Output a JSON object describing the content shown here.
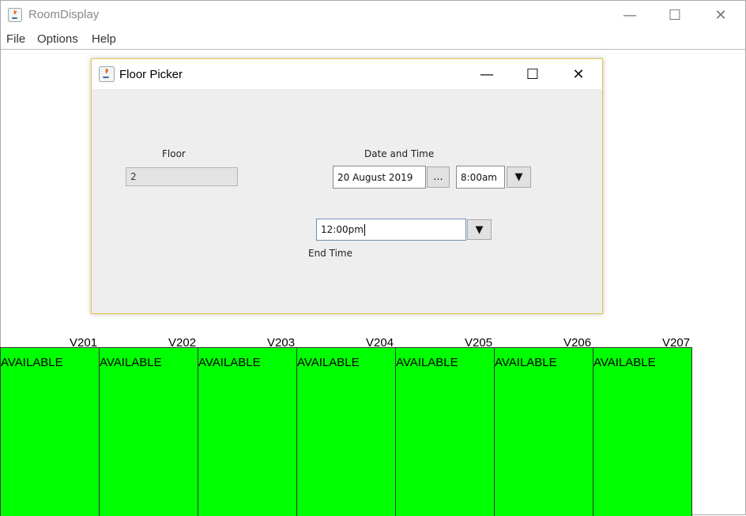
{
  "app": {
    "title": "RoomDisplay",
    "menu": [
      "File",
      "Options",
      "Help"
    ],
    "window_controls": {
      "minimize": "—",
      "maximize": "☐",
      "close": "✕"
    }
  },
  "rooms": [
    {
      "name": "V201",
      "status": "AVAILABLE"
    },
    {
      "name": "V202",
      "status": "AVAILABLE"
    },
    {
      "name": "V203",
      "status": "AVAILABLE"
    },
    {
      "name": "V204",
      "status": "AVAILABLE"
    },
    {
      "name": "V205",
      "status": "AVAILABLE"
    },
    {
      "name": "V206",
      "status": "AVAILABLE"
    },
    {
      "name": "V207",
      "status": "AVAILABLE"
    }
  ],
  "colors": {
    "available": "#00ff00",
    "dialog_border": "#e6c34a"
  },
  "dialog": {
    "title": "Floor Picker",
    "floor_label": "Floor",
    "floor_value": "2",
    "datetime_label": "Date and Time",
    "date_value": "20 August 2019",
    "date_picker_button": "...",
    "start_time_value": "8:00am",
    "dropdown_arrow": "▼",
    "end_time_value": "12:00pm",
    "end_time_label": "End Time"
  }
}
